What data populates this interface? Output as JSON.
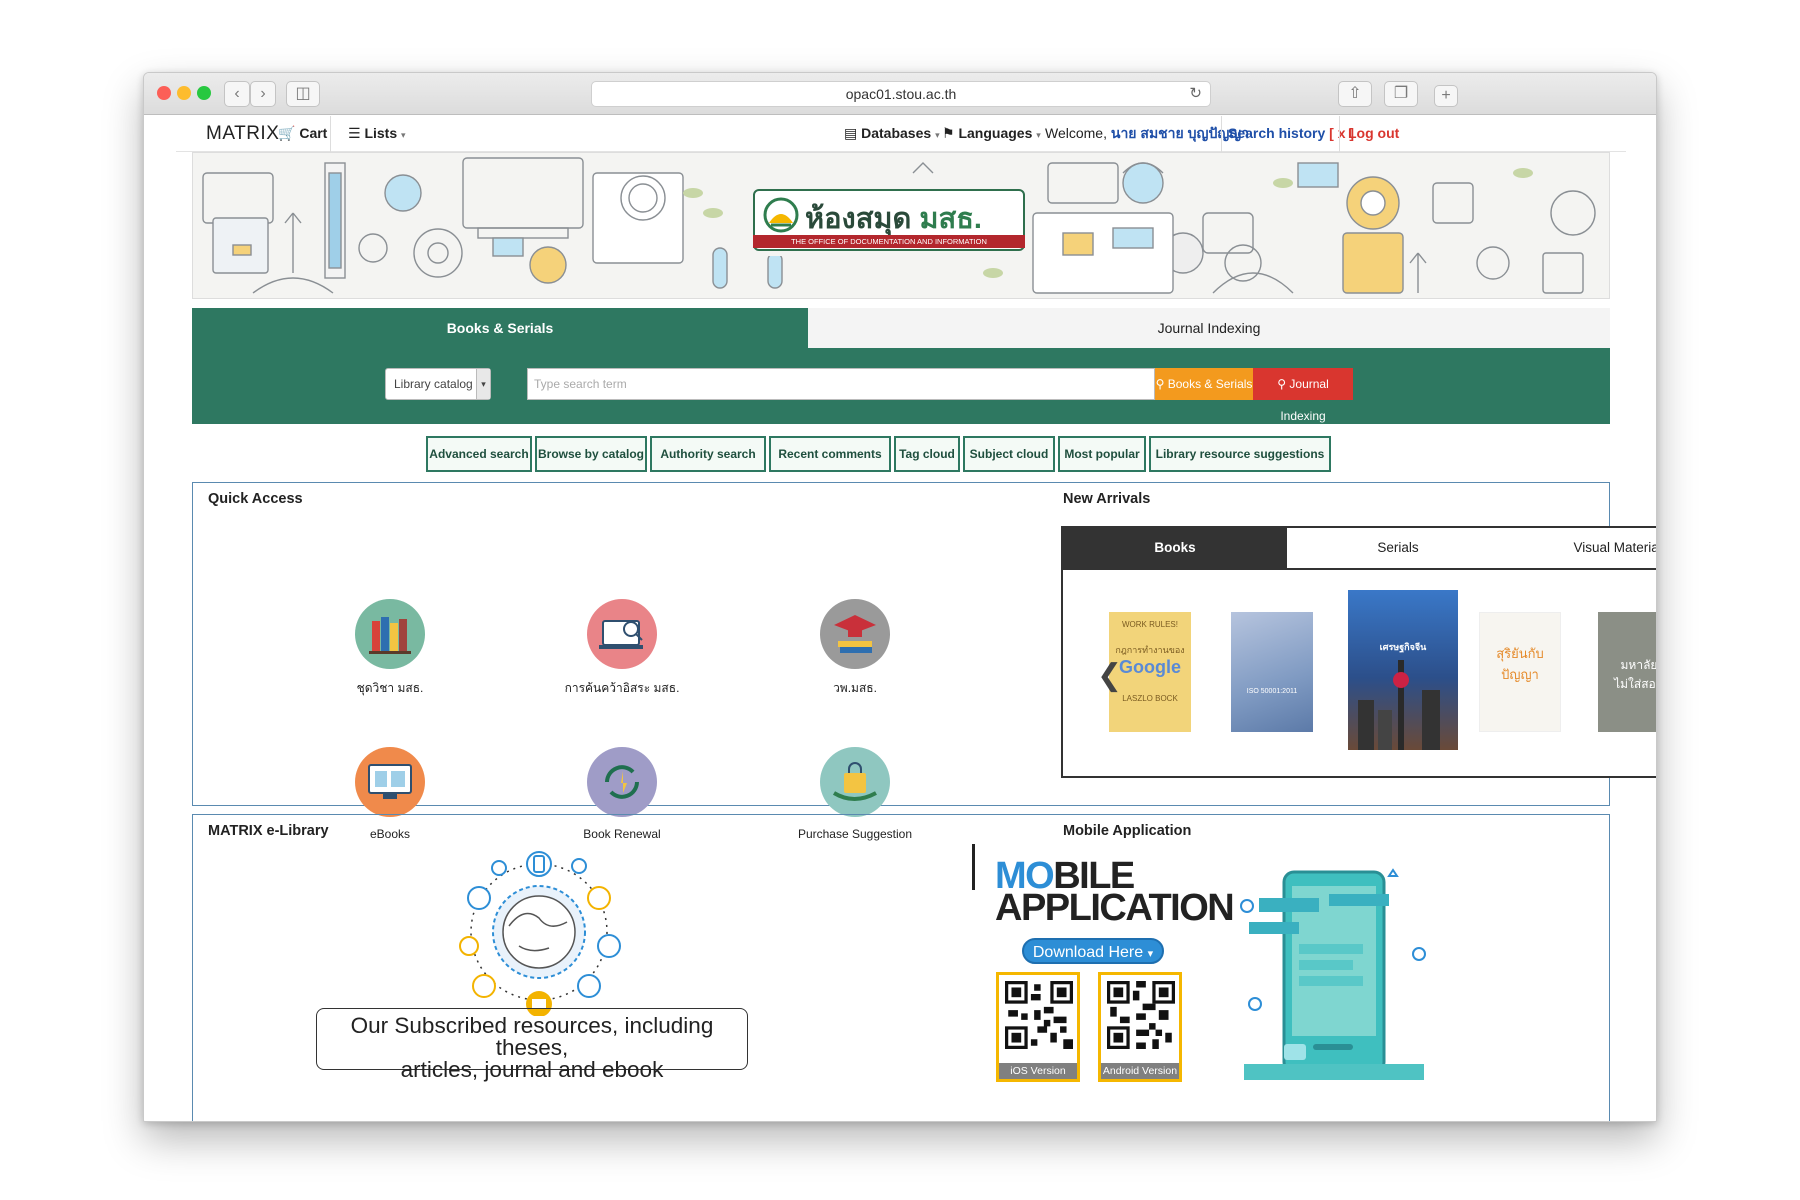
{
  "browser": {
    "url": "opac01.stou.ac.th"
  },
  "nav": {
    "brand": "MATRIX",
    "cart": "Cart",
    "lists": "Lists",
    "databases": "Databases",
    "languages": "Languages",
    "welcome_prefix": "Welcome,",
    "user_name": "นาย สมชาย บุญปัญญา",
    "search_history": "Search history",
    "search_history_clear": "[ x ]",
    "logout": "Log out"
  },
  "banner": {
    "logo_title_a": "ห้องสมุด",
    "logo_title_b": "มสธ.",
    "logo_subtitle": "THE OFFICE OF DOCUMENTATION AND INFORMATION"
  },
  "search": {
    "tabs": [
      {
        "label": "Books & Serials",
        "active": true
      },
      {
        "label": "Journal Indexing",
        "active": false
      }
    ],
    "scope": "Library catalog",
    "placeholder": "Type search term",
    "btn_books": "Books & Serials",
    "btn_journal": "Journal Indexing"
  },
  "links": [
    "Advanced search",
    "Browse by catalog",
    "Authority search",
    "Recent comments",
    "Tag cloud",
    "Subject cloud",
    "Most popular",
    "Library resource suggestions"
  ],
  "quick_access": {
    "title": "Quick Access",
    "items": [
      {
        "label": "ชุดวิชา มสธ.",
        "icon": "books-icon"
      },
      {
        "label": "การค้นคว้าอิสระ มสธ.",
        "icon": "laptop-search-icon"
      },
      {
        "label": "วพ.มสธ.",
        "icon": "graduation-cap-icon"
      },
      {
        "label": "eBooks",
        "icon": "ebook-icon"
      },
      {
        "label": "Book Renewal",
        "icon": "renew-icon"
      },
      {
        "label": "Purchase Suggestion",
        "icon": "shopping-bag-icon"
      }
    ]
  },
  "new_arrivals": {
    "title": "New Arrivals",
    "tabs": [
      "Books",
      "Serials",
      "Visual Materials"
    ],
    "covers": [
      {
        "text_top": "WORK RULES!",
        "text_mid": "กฎการทำงานของ",
        "text_main": "Google",
        "text_bot": "LASZLO BOCK"
      },
      {
        "text_top": "",
        "text_mid": "ISO 50001:2011",
        "text_main": "",
        "text_bot": ""
      },
      {
        "text_top": "",
        "text_mid": "เศรษฐกิจจีน",
        "text_main": "",
        "text_bot": ""
      },
      {
        "text_top": "",
        "text_mid": "สุริยันกับปัญญา",
        "text_main": "",
        "text_bot": ""
      },
      {
        "text_top": "",
        "text_mid": "มหาลัย",
        "text_main": "ไม่ใส่สอน",
        "text_bot": ""
      }
    ]
  },
  "elibrary": {
    "title": "MATRIX e-Library",
    "caption_line1": "Our Subscribed resources, including theses,",
    "caption_line2": "articles, journal and ebook"
  },
  "mobile": {
    "title": "Mobile Application",
    "headline_a": "MO",
    "headline_b": "BILE",
    "headline_c": "APPLICATION",
    "download": "Download Here",
    "ios": "iOS Version",
    "android": "Android Version"
  },
  "colors": {
    "green": "#2e7861",
    "orange": "#f39a1e",
    "red": "#d9362f",
    "blue_border": "#5a8ab0"
  }
}
